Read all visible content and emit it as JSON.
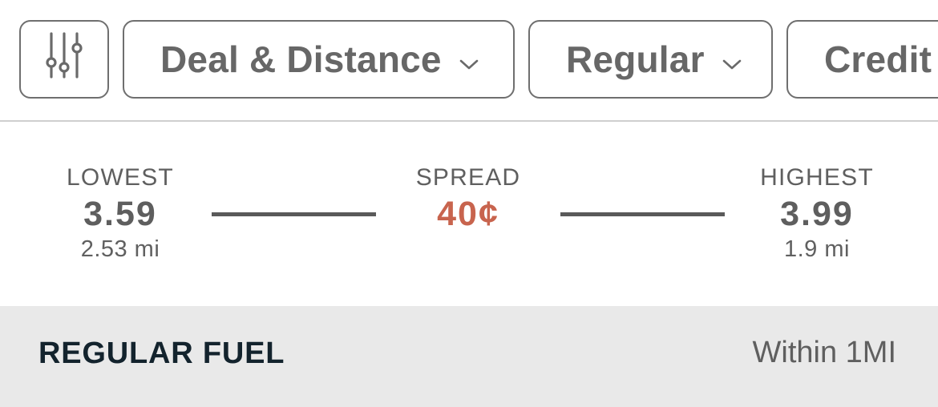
{
  "filters": {
    "filter_icon": "sliders-icon",
    "chips": [
      {
        "label": "Deal & Distance",
        "icon": "chevron-down-icon"
      },
      {
        "label": "Regular",
        "icon": "chevron-down-icon"
      },
      {
        "label": "Credit"
      }
    ]
  },
  "price_range": {
    "lowest": {
      "label": "LOWEST",
      "price": "3.59",
      "distance": "2.53 mi"
    },
    "spread": {
      "label": "SPREAD",
      "value": "40¢"
    },
    "highest": {
      "label": "HIGHEST",
      "price": "3.99",
      "distance": "1.9 mi"
    }
  },
  "section": {
    "title": "REGULAR FUEL",
    "radius": "Within 1MI"
  },
  "colors": {
    "spread_accent": "#c8644e",
    "section_bg": "#e9e9e9",
    "title_dark": "#13232d",
    "chip_border": "#6f6f6f"
  }
}
